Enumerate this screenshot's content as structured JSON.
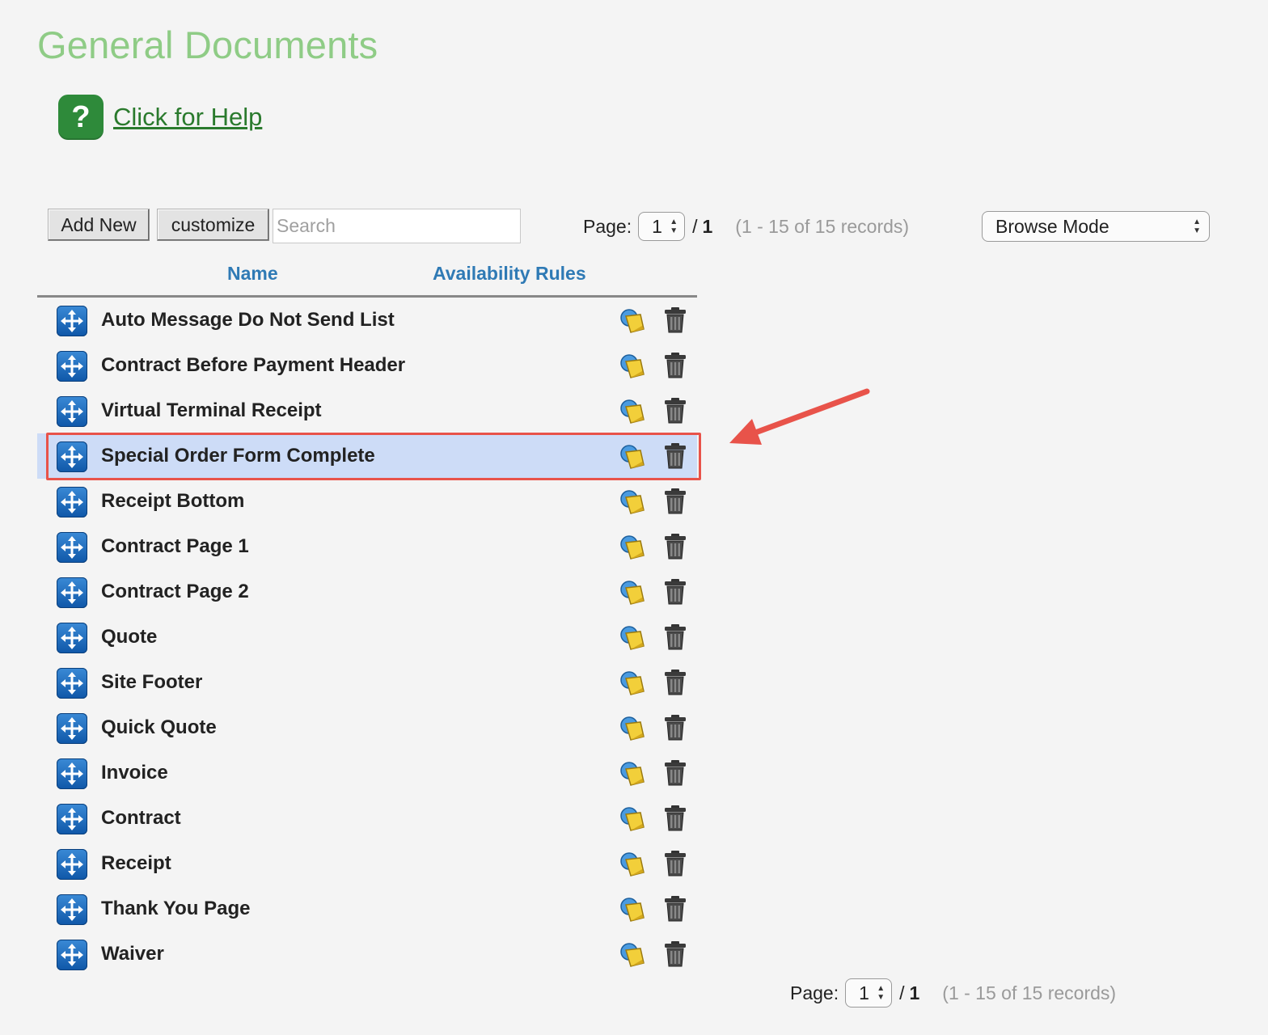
{
  "page": {
    "title": "General Documents"
  },
  "help": {
    "label": "Click for Help",
    "icon": "help-icon"
  },
  "toolbar": {
    "add_new_label": "Add New",
    "customize_label": "customize",
    "search_placeholder": "Search"
  },
  "pager_top": {
    "label": "Page:",
    "current": "1",
    "slash": "/",
    "total": "1",
    "records": "(1 - 15 of 15 records)"
  },
  "pager_bottom": {
    "label": "Page:",
    "current": "1",
    "slash": "/",
    "total": "1",
    "records": "(1 - 15 of 15 records)"
  },
  "mode_select": {
    "selected": "Browse Mode"
  },
  "columns": {
    "name": "Name",
    "rules": "Availability Rules"
  },
  "rows": [
    {
      "name": "Auto Message Do Not Send List"
    },
    {
      "name": "Contract Before Payment Header"
    },
    {
      "name": "Virtual Terminal Receipt"
    },
    {
      "name": "Special Order Form Complete",
      "selected": true
    },
    {
      "name": "Receipt Bottom"
    },
    {
      "name": "Contract Page 1"
    },
    {
      "name": "Contract Page 2"
    },
    {
      "name": "Quote"
    },
    {
      "name": "Site Footer"
    },
    {
      "name": "Quick Quote"
    },
    {
      "name": "Invoice"
    },
    {
      "name": "Contract"
    },
    {
      "name": "Receipt"
    },
    {
      "name": "Thank You Page"
    },
    {
      "name": "Waiver"
    }
  ],
  "colors": {
    "title": "#8fcc86",
    "help_green": "#2e8a3a",
    "header_blue": "#2f7ab5",
    "selected_row": "#cddcf7",
    "annotation_red": "#e8534a"
  }
}
